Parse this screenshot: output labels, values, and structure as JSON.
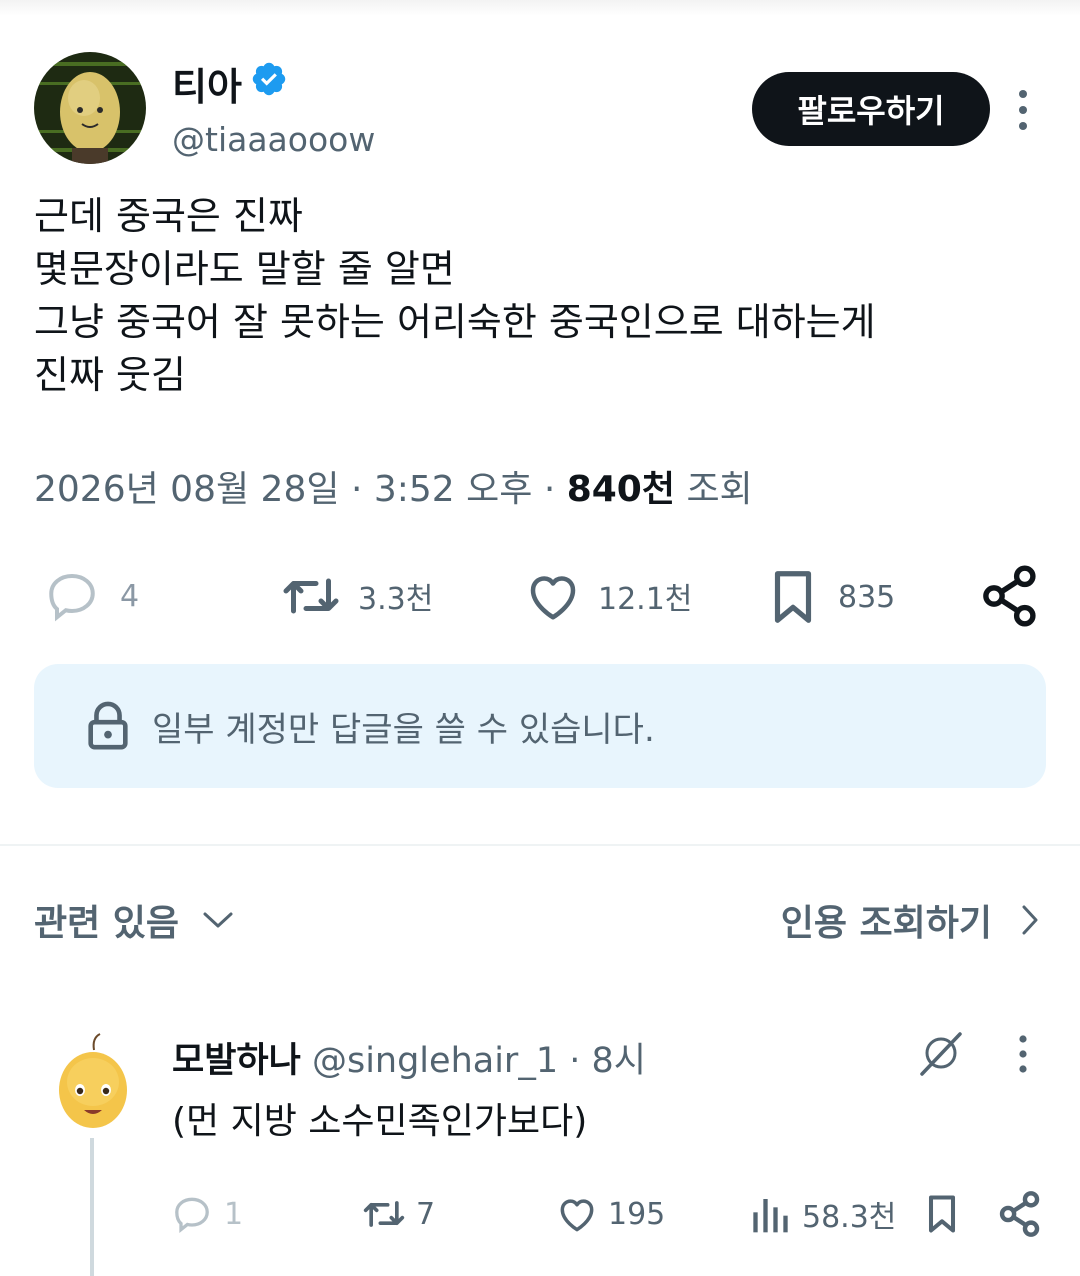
{
  "tweet": {
    "author_name": "티아",
    "author_handle": "@tiaaaooow",
    "follow_label": "팔로우하기",
    "text": "근데 중국은 진짜\n몇문장이라도 말할 줄 알면\n그냥 중국어 잘 못하는 어리숙한 중국인으로 대하는게\n진짜 웃김",
    "date": "2026년 08월 28일",
    "time": "3:52 오후",
    "views_count": "840천",
    "views_label": "조회",
    "stats": {
      "replies": "4",
      "retweets": "3.3천",
      "likes": "12.1천",
      "bookmarks": "835"
    }
  },
  "reply_restriction": {
    "text": "일부 계정만 답글을 쓸 수 있습니다."
  },
  "section": {
    "related_label": "관련 있음",
    "quotes_label": "인용 조회하기"
  },
  "reply": {
    "name": "모발하나",
    "handle": "@singlehair_1",
    "time": "8시",
    "text": "(먼 지방 소수민족인가보다)",
    "stats": {
      "replies": "1",
      "retweets": "7",
      "likes": "195",
      "views": "58.3천"
    }
  },
  "colors": {
    "text_primary": "#0f1419",
    "text_secondary": "#536471",
    "verified_blue": "#1d9bf0",
    "restrict_bg": "#e8f5fd"
  }
}
